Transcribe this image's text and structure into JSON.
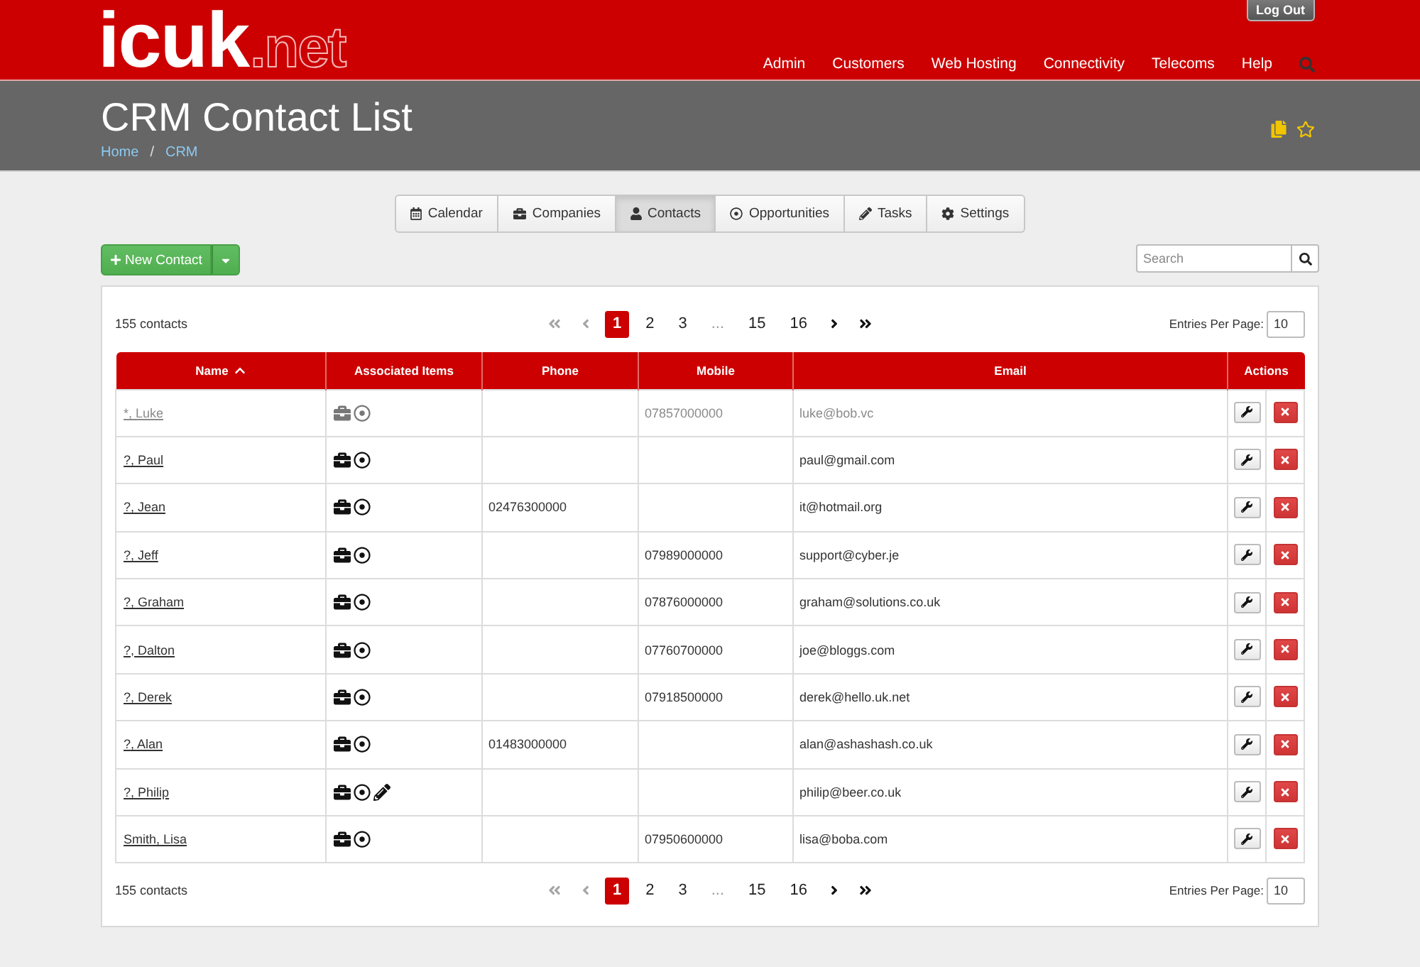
{
  "header": {
    "logo": {
      "main": "icuk",
      "suffix": ".net"
    },
    "logout_button": "Log Out",
    "nav": [
      "Admin",
      "Customers",
      "Web Hosting",
      "Connectivity",
      "Telecoms",
      "Help"
    ]
  },
  "page_header": {
    "title": "CRM Contact List",
    "breadcrumb": [
      "Home",
      "CRM"
    ],
    "separator": "/"
  },
  "tabs": [
    {
      "label": "Calendar",
      "kind": "calendar",
      "selected": false
    },
    {
      "label": "Companies",
      "kind": "company",
      "selected": false
    },
    {
      "label": "Contacts",
      "kind": "contact",
      "selected": true
    },
    {
      "label": "Opportunities",
      "kind": "opportunity",
      "selected": false
    },
    {
      "label": "Tasks",
      "kind": "task",
      "selected": false
    },
    {
      "label": "Settings",
      "kind": "settings",
      "selected": false
    }
  ],
  "new_contact_button": {
    "label": "New Contact"
  },
  "search": {
    "placeholder": "Search"
  },
  "top_bar": {
    "count": "155 contacts",
    "pagination": [
      {
        "kind": "first",
        "disabled": true
      },
      {
        "kind": "prev",
        "disabled": true
      },
      {
        "kind": "page",
        "label": "1",
        "selected": true
      },
      {
        "kind": "page",
        "label": "2",
        "selected": false
      },
      {
        "kind": "page",
        "label": "3",
        "selected": false
      },
      {
        "kind": "ellipsis",
        "label": "..."
      },
      {
        "kind": "page",
        "label": "15",
        "selected": false
      },
      {
        "kind": "page",
        "label": "16",
        "selected": false
      },
      {
        "kind": "next",
        "disabled": false
      },
      {
        "kind": "last",
        "disabled": false
      }
    ],
    "entries_label": "Entries Per Page:",
    "entries_value": "10"
  },
  "table": {
    "columns": [
      {
        "label": "Name",
        "sorted": true
      },
      {
        "label": "Associated Items",
        "sorted": false
      },
      {
        "label": "Phone",
        "sorted": false
      },
      {
        "label": "Mobile",
        "sorted": false
      },
      {
        "label": "Email",
        "sorted": false
      },
      {
        "label": "Actions",
        "sorted": false
      }
    ],
    "rows": [
      {
        "name": "*, Luke",
        "inactive": true,
        "associated_items": [
          {
            "kind": "company"
          },
          {
            "kind": "opportunity"
          }
        ],
        "mobile": "07857000000",
        "email": "luke@bob.vc"
      },
      {
        "name": "?, Paul",
        "inactive": false,
        "associated_items": [
          {
            "kind": "company"
          },
          {
            "kind": "opportunity"
          }
        ],
        "email": "paul@gmail.com"
      },
      {
        "name": "?, Jean",
        "inactive": false,
        "associated_items": [
          {
            "kind": "company"
          },
          {
            "kind": "opportunity"
          }
        ],
        "phone": "02476300000",
        "email": "it@hotmail.org"
      },
      {
        "name": "?, Jeff",
        "inactive": false,
        "associated_items": [
          {
            "kind": "company"
          },
          {
            "kind": "opportunity"
          }
        ],
        "mobile": "07989000000",
        "email": "support@cyber.je"
      },
      {
        "name": "?, Graham",
        "inactive": false,
        "associated_items": [
          {
            "kind": "company"
          },
          {
            "kind": "opportunity"
          }
        ],
        "mobile": "07876000000",
        "email": "graham@solutions.co.uk"
      },
      {
        "name": "?, Dalton",
        "inactive": false,
        "associated_items": [
          {
            "kind": "company"
          },
          {
            "kind": "opportunity"
          }
        ],
        "mobile": "07760700000",
        "email": "joe@bloggs.com"
      },
      {
        "name": "?, Derek",
        "inactive": false,
        "associated_items": [
          {
            "kind": "company"
          },
          {
            "kind": "opportunity"
          }
        ],
        "mobile": "07918500000",
        "email": "derek@hello.uk.net"
      },
      {
        "name": "?, Alan",
        "inactive": false,
        "associated_items": [
          {
            "kind": "company"
          },
          {
            "kind": "opportunity"
          }
        ],
        "phone": "01483000000",
        "email": "alan@ashashash.co.uk"
      },
      {
        "name": "?, Philip",
        "inactive": false,
        "associated_items": [
          {
            "kind": "company"
          },
          {
            "kind": "opportunity"
          },
          {
            "kind": "task"
          }
        ],
        "email": "philip@beer.co.uk"
      },
      {
        "name": "Smith, Lisa",
        "inactive": false,
        "associated_items": [
          {
            "kind": "company"
          },
          {
            "kind": "opportunity"
          }
        ],
        "mobile": "07950600000",
        "email": "lisa@boba.com"
      }
    ]
  },
  "bottom_bar": {
    "count": "155 contacts",
    "pagination": [
      {
        "kind": "first",
        "disabled": true
      },
      {
        "kind": "prev",
        "disabled": true
      },
      {
        "kind": "page",
        "label": "1",
        "selected": true
      },
      {
        "kind": "page",
        "label": "2",
        "selected": false
      },
      {
        "kind": "page",
        "label": "3",
        "selected": false
      },
      {
        "kind": "ellipsis",
        "label": "..."
      },
      {
        "kind": "page",
        "label": "15",
        "selected": false
      },
      {
        "kind": "page",
        "label": "16",
        "selected": false
      },
      {
        "kind": "next",
        "disabled": false
      },
      {
        "kind": "last",
        "disabled": false
      }
    ],
    "entries_label": "Entries Per Page:",
    "entries_value": "10"
  }
}
